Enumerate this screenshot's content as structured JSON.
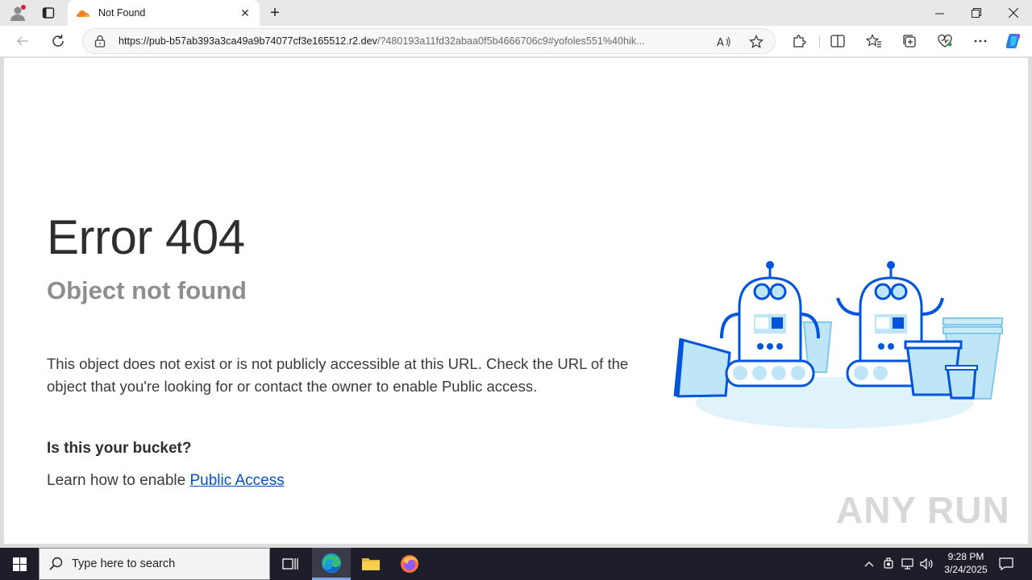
{
  "browser": {
    "tab_title": "Not Found",
    "url_host": "https://pub-b57ab393a3ca49a9b74077cf3e165512.r2.dev",
    "url_rest": "/?480193a11fd32abaa0f5b4666706c9#yofoles551%40hik...",
    "icons": [
      "profile-icon",
      "tab-actions-icon",
      "close-tab-icon",
      "new-tab-icon",
      "minimize-icon",
      "restore-icon",
      "close-window-icon",
      "back-icon",
      "refresh-icon",
      "lock-icon",
      "read-aloud-icon",
      "favorite-icon",
      "extensions-icon",
      "split-screen-icon",
      "favorites-icon",
      "collections-icon",
      "browser-essentials-icon",
      "more-icon",
      "copilot-icon"
    ]
  },
  "page": {
    "error_title": "Error 404",
    "error_subtitle": "Object not found",
    "description": "This object does not exist or is not publicly accessible at this URL. Check the URL of the object that you're looking for or contact the owner to enable Public access.",
    "bucket_question": "Is this your bucket?",
    "learn_prefix": "Learn how to enable ",
    "learn_link": "Public Access",
    "watermark": "ANY RUN"
  },
  "taskbar": {
    "search_placeholder": "Type here to search",
    "time": "9:28 PM",
    "date": "3/24/2025"
  },
  "colors": {
    "link": "#0051c3",
    "robot_blue": "#0055dc",
    "robot_light": "#bfe6f6"
  }
}
